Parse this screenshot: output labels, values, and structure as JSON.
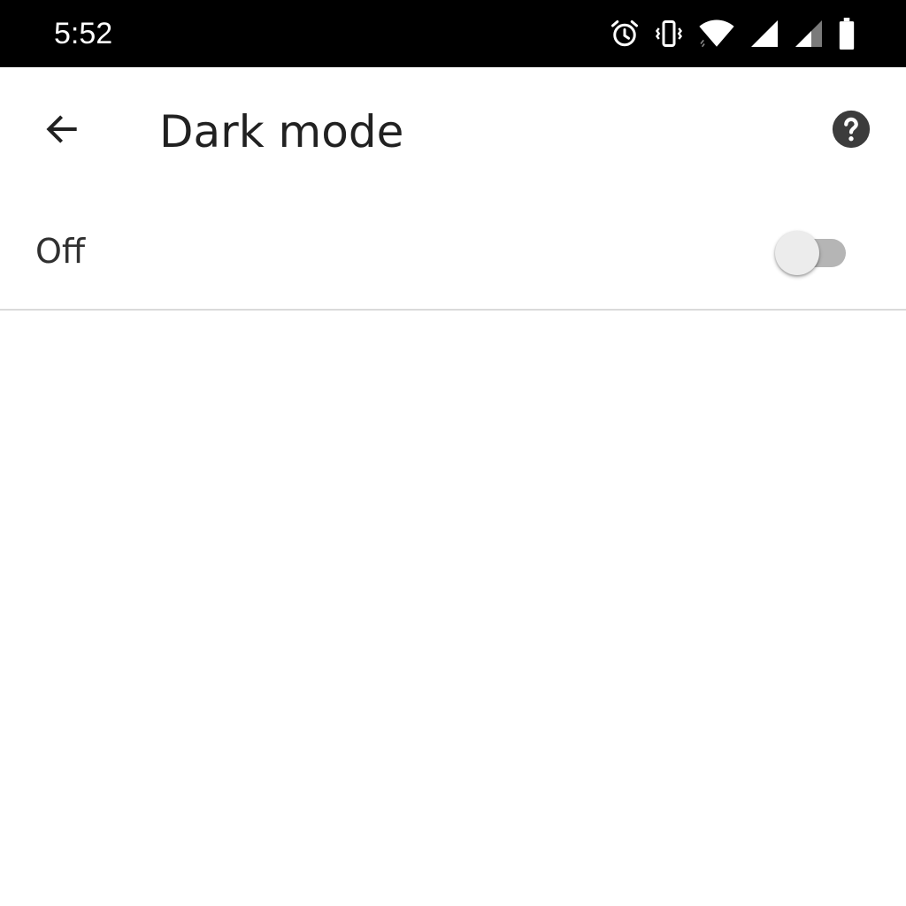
{
  "status_bar": {
    "time": "5:52",
    "icons": [
      "alarm-icon",
      "vibrate-icon",
      "wifi-icon",
      "signal-icon",
      "signal-icon",
      "battery-icon"
    ]
  },
  "app_bar": {
    "title": "Dark mode",
    "back_icon": "arrow-back-icon",
    "help_icon": "help-circle-icon"
  },
  "setting": {
    "label": "Off",
    "toggle_state": "off"
  },
  "colors": {
    "status_bar_bg": "#000000",
    "background": "#ffffff",
    "text_primary": "#212121",
    "divider": "#dadada",
    "toggle_track_off": "#b5b5b5",
    "toggle_thumb_off": "#ececec"
  }
}
